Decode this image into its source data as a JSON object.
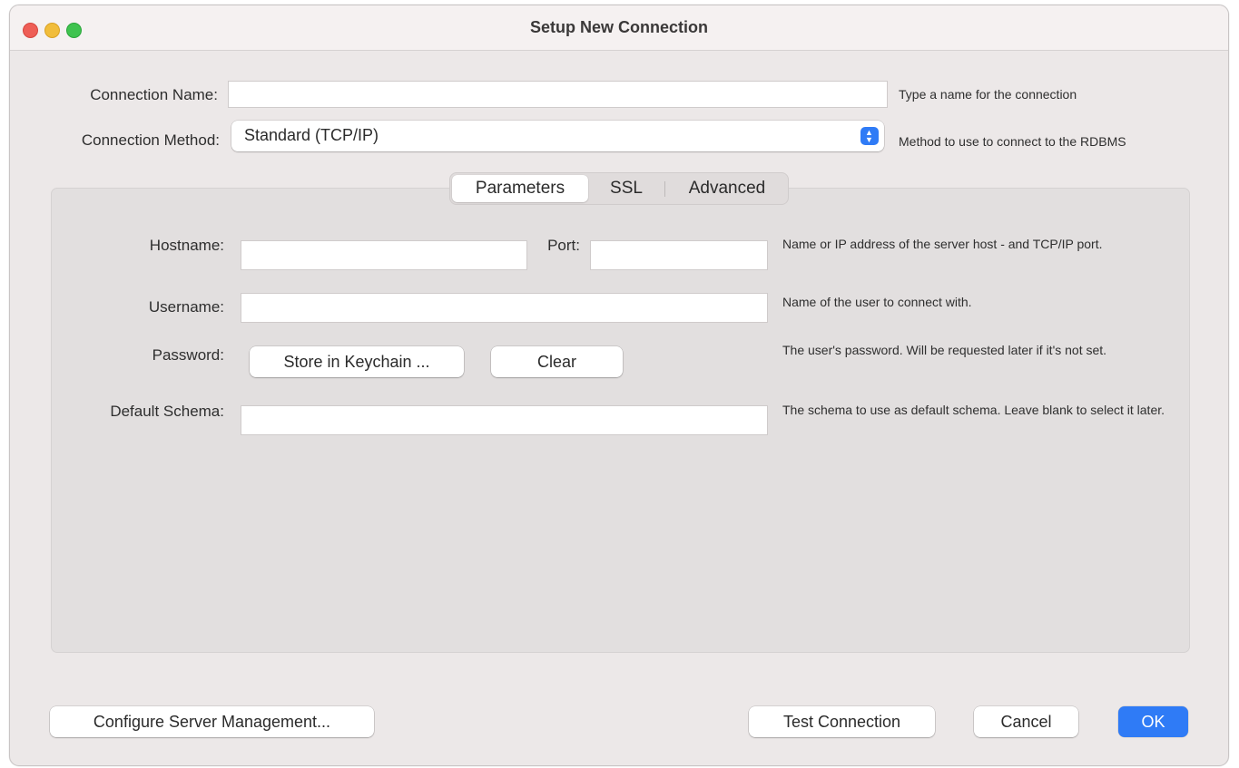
{
  "window": {
    "title": "Setup New Connection"
  },
  "connection_name": {
    "label": "Connection Name:",
    "value": "",
    "hint": "Type a name for the connection"
  },
  "connection_method": {
    "label": "Connection Method:",
    "value": "Standard (TCP/IP)",
    "hint": "Method to use to connect to the RDBMS"
  },
  "tabs": [
    {
      "label": "Parameters",
      "active": true
    },
    {
      "label": "SSL",
      "active": false
    },
    {
      "label": "Advanced",
      "active": false
    }
  ],
  "params": {
    "hostname": {
      "label": "Hostname:",
      "value": ""
    },
    "port": {
      "label": "Port:",
      "value": ""
    },
    "host_hint": "Name or IP address of the server host - and TCP/IP port.",
    "username": {
      "label": "Username:",
      "value": "",
      "hint": "Name of the user to connect with."
    },
    "password": {
      "label": "Password:",
      "store_button": "Store in Keychain ...",
      "clear_button": "Clear",
      "hint": "The user's password. Will be requested later if it's not set."
    },
    "schema": {
      "label": "Default Schema:",
      "value": "",
      "hint": "The schema to use as default schema. Leave blank to select it later."
    }
  },
  "footer": {
    "configure": "Configure Server Management...",
    "test": "Test Connection",
    "cancel": "Cancel",
    "ok": "OK"
  },
  "colors": {
    "accent": "#2f7bf6",
    "close": "#ee5e56",
    "minimize": "#f1bd3b",
    "maximize": "#3fc34f"
  }
}
